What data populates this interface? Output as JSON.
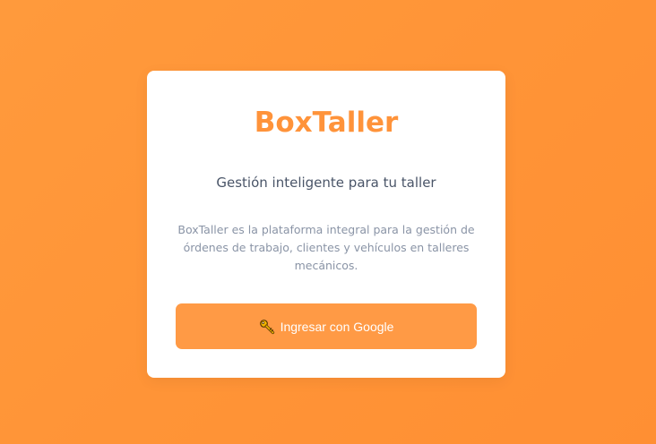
{
  "app": {
    "title": "BoxTaller",
    "subtitle": "Gestión inteligente para tu taller",
    "description": "BoxTaller es la plataforma integral para la gestión de órdenes de trabajo, clientes y vehículos en talleres mecánicos."
  },
  "login": {
    "button_label": "Ingresar con Google",
    "button_icon": "key-icon"
  },
  "colors": {
    "background": "#ff9437",
    "accent": "#ff933a",
    "button": "#ff9a45",
    "card": "#ffffff"
  }
}
